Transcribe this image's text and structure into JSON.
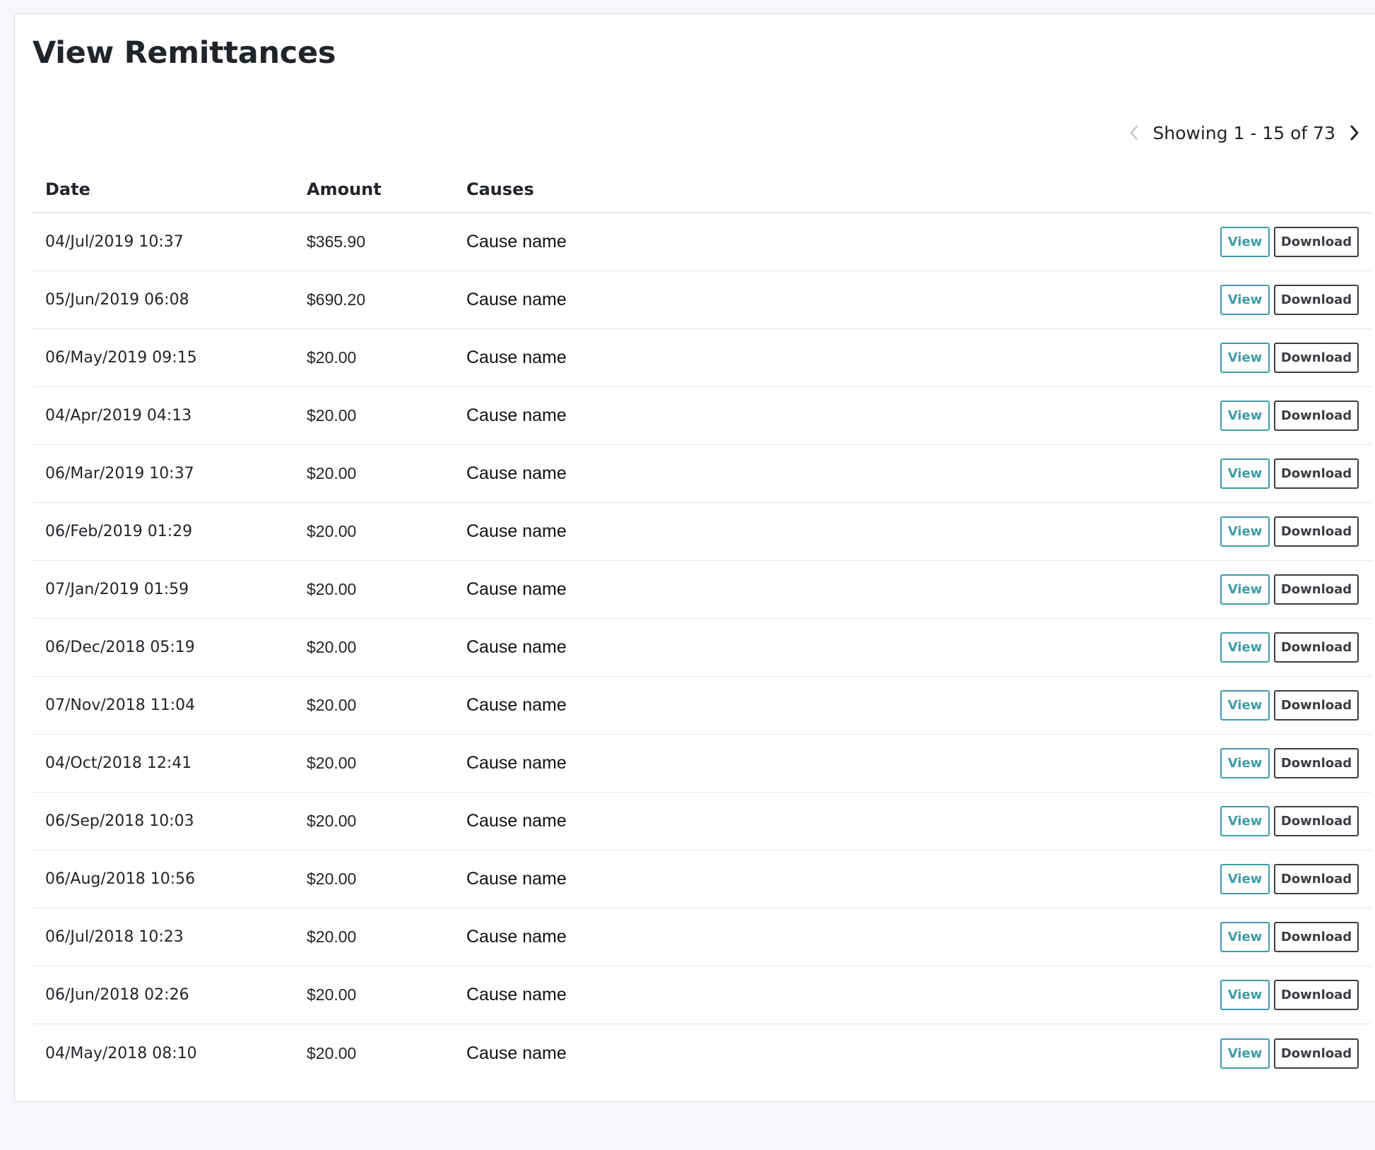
{
  "page": {
    "title": "View Remittances"
  },
  "pagination": {
    "text": "Showing 1 - 15 of 73",
    "prev_icon": "chevron-left-icon",
    "next_icon": "chevron-right-icon",
    "prev_disabled": true
  },
  "table": {
    "headers": {
      "date": "Date",
      "amount": "Amount",
      "causes": "Causes"
    },
    "rows": [
      {
        "date": "04/Jul/2019 10:37",
        "amount": "$365.90",
        "cause": "Cause name",
        "view": "View",
        "download": "Download"
      },
      {
        "date": "05/Jun/2019 06:08",
        "amount": "$690.20",
        "cause": "Cause name",
        "view": "View",
        "download": "Download"
      },
      {
        "date": "06/May/2019 09:15",
        "amount": "$20.00",
        "cause": "Cause name",
        "view": "View",
        "download": "Download"
      },
      {
        "date": "04/Apr/2019 04:13",
        "amount": "$20.00",
        "cause": "Cause name",
        "view": "View",
        "download": "Download"
      },
      {
        "date": "06/Mar/2019 10:37",
        "amount": "$20.00",
        "cause": "Cause name",
        "view": "View",
        "download": "Download"
      },
      {
        "date": "06/Feb/2019 01:29",
        "amount": "$20.00",
        "cause": "Cause name",
        "view": "View",
        "download": "Download"
      },
      {
        "date": "07/Jan/2019 01:59",
        "amount": "$20.00",
        "cause": "Cause name",
        "view": "View",
        "download": "Download"
      },
      {
        "date": "06/Dec/2018 05:19",
        "amount": "$20.00",
        "cause": "Cause name",
        "view": "View",
        "download": "Download"
      },
      {
        "date": "07/Nov/2018 11:04",
        "amount": "$20.00",
        "cause": "Cause name",
        "view": "View",
        "download": "Download"
      },
      {
        "date": "04/Oct/2018 12:41",
        "amount": "$20.00",
        "cause": "Cause name",
        "view": "View",
        "download": "Download"
      },
      {
        "date": "06/Sep/2018 10:03",
        "amount": "$20.00",
        "cause": "Cause name",
        "view": "View",
        "download": "Download"
      },
      {
        "date": "06/Aug/2018 10:56",
        "amount": "$20.00",
        "cause": "Cause name",
        "view": "View",
        "download": "Download"
      },
      {
        "date": "06/Jul/2018 10:23",
        "amount": "$20.00",
        "cause": "Cause name",
        "view": "View",
        "download": "Download"
      },
      {
        "date": "06/Jun/2018 02:26",
        "amount": "$20.00",
        "cause": "Cause name",
        "view": "View",
        "download": "Download"
      },
      {
        "date": "04/May/2018 08:10",
        "amount": "$20.00",
        "cause": "Cause name",
        "view": "View",
        "download": "Download"
      }
    ]
  },
  "colors": {
    "background": "#f6f7fb",
    "card": "#ffffff",
    "view_accent": "#3d9ca8",
    "download_border": "#3a3d42",
    "row_divider": "#e3e5e8"
  }
}
